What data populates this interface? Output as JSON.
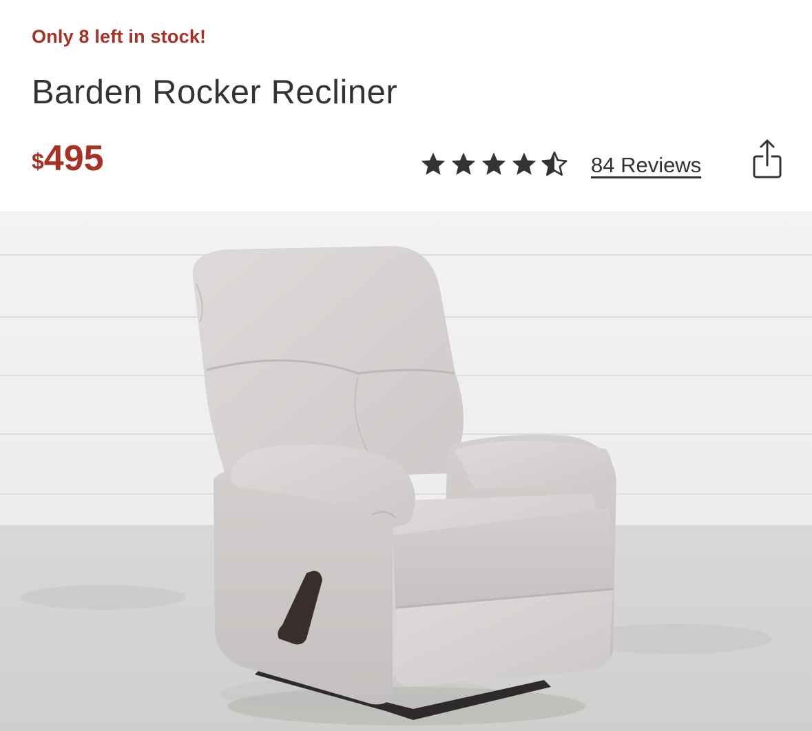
{
  "product": {
    "stock_notice": "Only 8 left in stock!",
    "title": "Barden Rocker Recliner",
    "price_currency": "$",
    "price_amount": "495",
    "rating": 4.5,
    "rating_max": 5,
    "reviews_label": "84 Reviews"
  },
  "colors": {
    "accent_red": "#a63124",
    "text_dark": "#333333",
    "upholstery": "#d7d3d2"
  },
  "icons": {
    "share": "share-icon",
    "star_full": "star-icon",
    "star_half": "star-half-icon"
  }
}
